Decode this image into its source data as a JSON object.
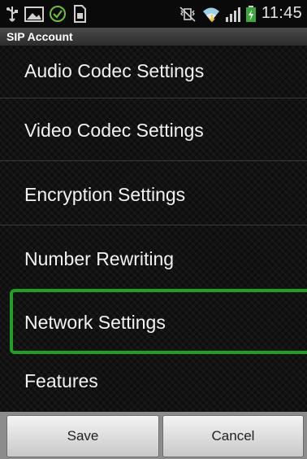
{
  "status_bar": {
    "icons_left": [
      "usb-icon",
      "image-icon",
      "check-circle-icon",
      "sim-card-icon"
    ],
    "icons_right": [
      "no-vibrate-icon",
      "wifi-icon",
      "signal-icon",
      "battery-icon"
    ],
    "time": "11:45"
  },
  "title": "SIP Account",
  "menu": {
    "items": [
      {
        "label": "Audio Codec Settings"
      },
      {
        "label": "Video Codec Settings"
      },
      {
        "label": "Encryption Settings"
      },
      {
        "label": "Number Rewriting"
      },
      {
        "label": "Network Settings",
        "highlighted": true
      },
      {
        "label": "Features"
      }
    ]
  },
  "buttons": {
    "save": "Save",
    "cancel": "Cancel"
  },
  "colors": {
    "highlight": "#1fa023",
    "background": "#121212",
    "title_bar": "#3a3a3a",
    "button_bar": "#8c8c8c"
  }
}
